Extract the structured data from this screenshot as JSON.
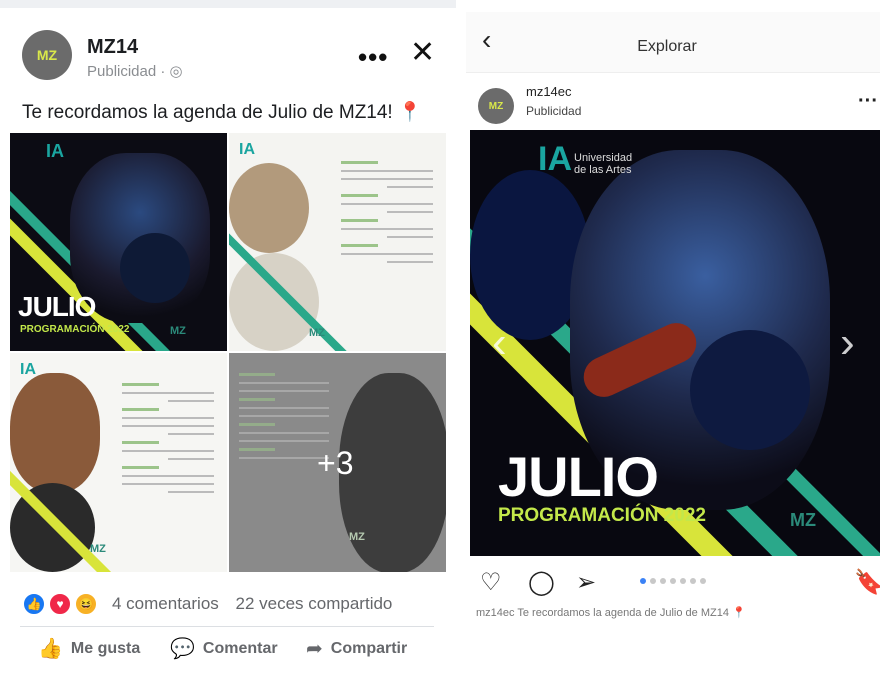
{
  "facebook": {
    "page_name": "MZ14",
    "subtitle": "Publicidad · ",
    "post_text": "Te recordamos la agenda de Julio de MZ14! ",
    "images": {
      "main_julio": "JULIO",
      "main_prog": "PROGRAMACIÓN 2022",
      "more_count": "+3",
      "logo_mark": "MZ",
      "logo_text": "Universidad de las Artes"
    },
    "stats": {
      "comments": "4 comentarios",
      "shares": "22 veces compartido"
    },
    "actions": {
      "like": "Me gusta",
      "comment": "Comentar",
      "share": "Compartir"
    }
  },
  "instagram": {
    "header_title": "Explorar",
    "username": "mz14ec",
    "subtitle": "Publicidad",
    "image": {
      "logo_text": "Universidad de las Artes",
      "title": "JULIO",
      "subtitle": "PROGRAMACIÓN 2022",
      "logo_mark": "MZ"
    },
    "caption": "mz14ec Te recordamos la agenda de Julio de MZ14",
    "carousel_total": 7,
    "carousel_active": 1
  },
  "colors": {
    "accent_green": "#2aa88a",
    "accent_yellow": "#d8e43a",
    "fb_like_blue": "#1877f2",
    "fb_love_red": "#f02849"
  }
}
